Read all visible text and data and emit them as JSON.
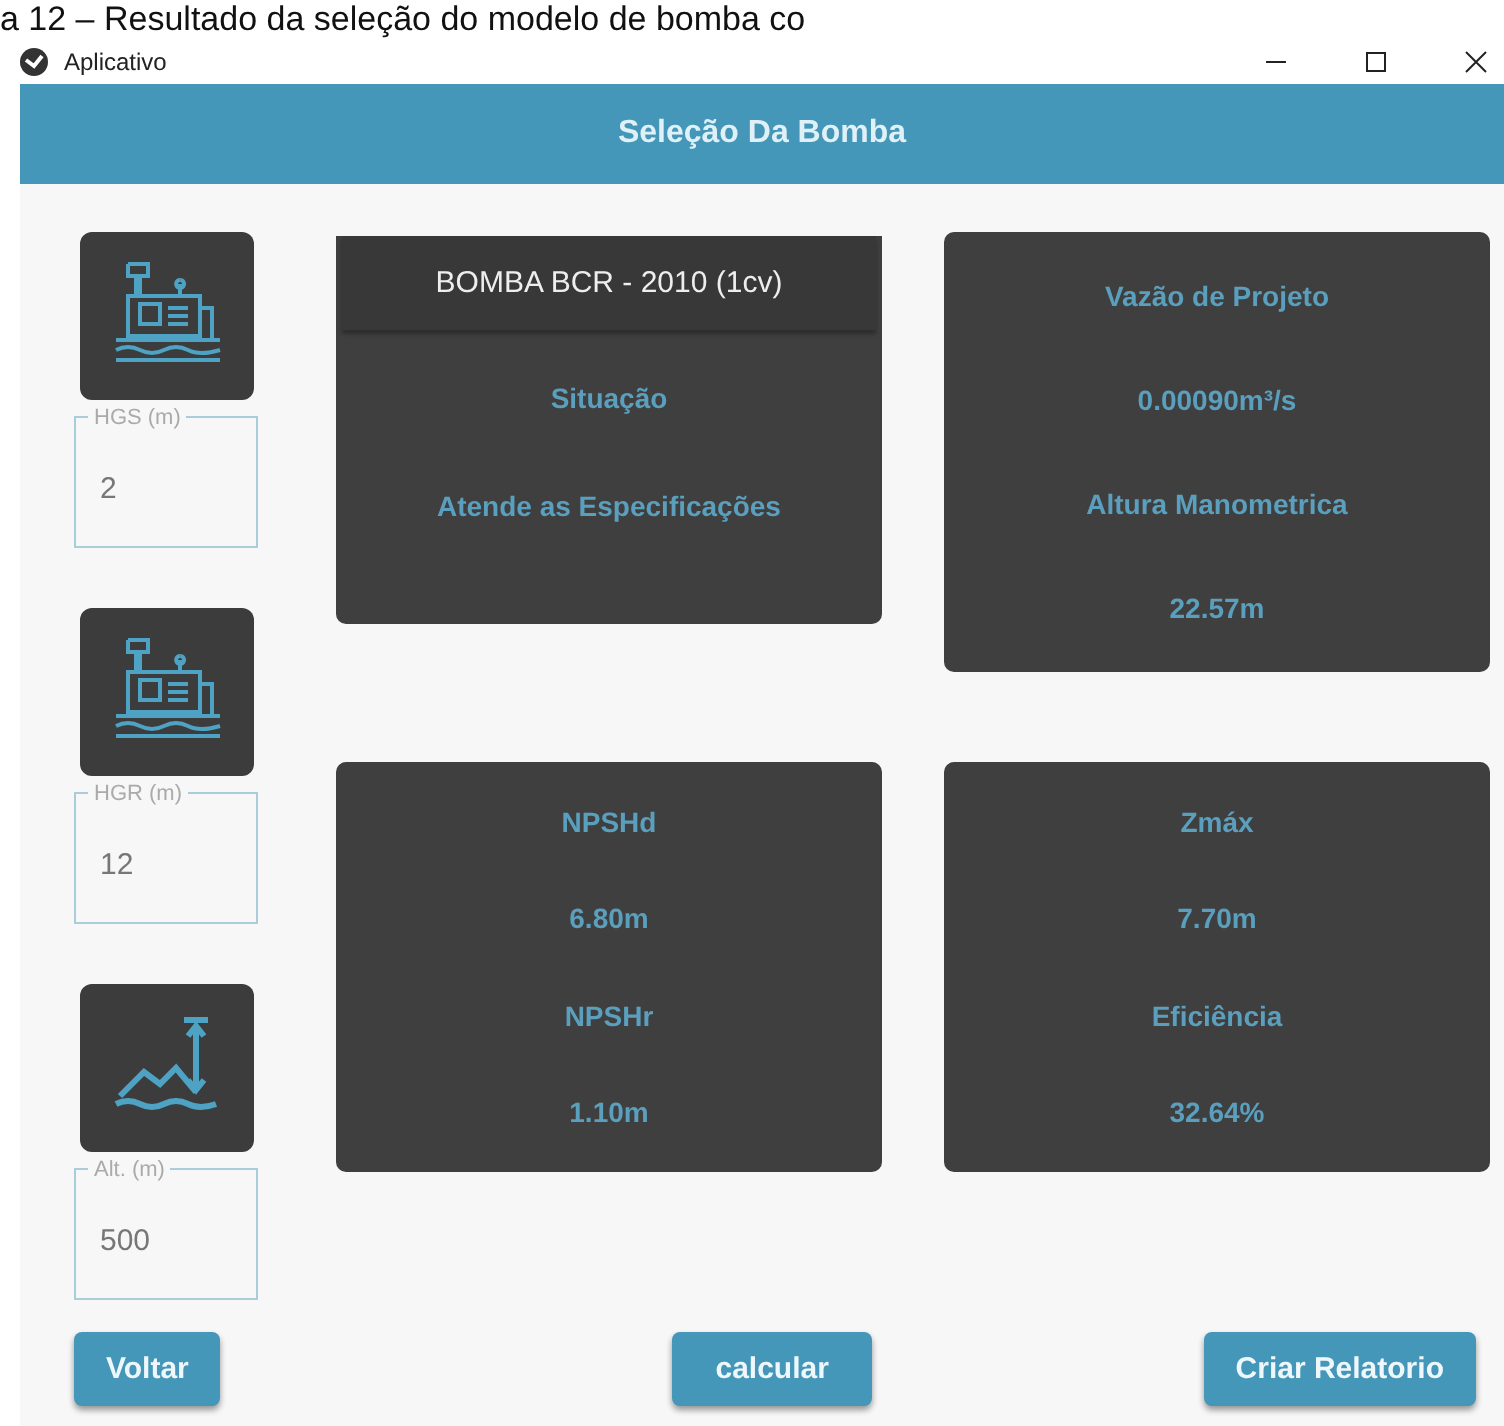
{
  "caption": "a 12 – Resultado da seleção do modelo de bomba co",
  "window": {
    "title": "Aplicativo"
  },
  "header": {
    "title": "Seleção Da Bomba"
  },
  "inputs": [
    {
      "kind": "pump",
      "label": "HGS (m)",
      "value": "2"
    },
    {
      "kind": "pump",
      "label": "HGR (m)",
      "value": "12"
    },
    {
      "kind": "altitude",
      "label": "Alt. (m)",
      "value": "500"
    }
  ],
  "cards": [
    {
      "title": "BOMBA BCR - 2010 (1cv)",
      "lines": [
        "Situação",
        "Atende as Especificações"
      ]
    },
    {
      "lines": [
        "Vazão de Projeto",
        "0.00090m³/s",
        "Altura Manometrica",
        "22.57m"
      ]
    },
    {
      "lines": [
        "NPSHd",
        "6.80m",
        "NPSHr",
        "1.10m"
      ]
    },
    {
      "lines": [
        "Zmáx",
        "7.70m",
        "Eficiência",
        "32.64%"
      ]
    }
  ],
  "buttons": [
    "Voltar",
    "calcular",
    "Criar Relatorio"
  ]
}
